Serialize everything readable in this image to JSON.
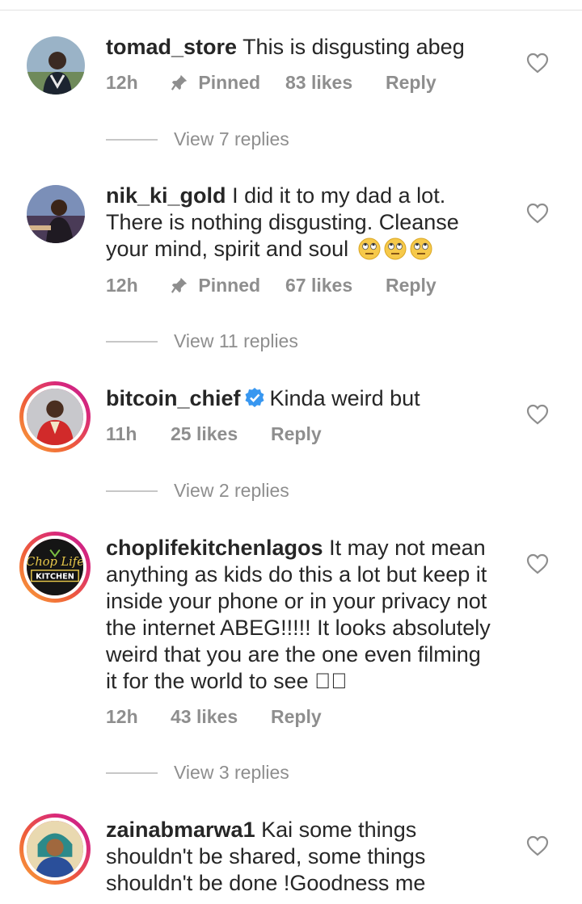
{
  "comments": [
    {
      "username": "tomad_store",
      "text": "This is disgusting abeg",
      "time": "12h",
      "pinned_label": "Pinned",
      "likes": "83 likes",
      "reply_label": "Reply",
      "view_replies": "View 7 replies",
      "avatar_ring": false
    },
    {
      "username": "nik_ki_gold",
      "text_lines": [
        "I did it to my dad a lot.",
        "There is nothing disgusting. Cleanse",
        "your mind, spirit and soul"
      ],
      "emoji": [
        "face-with-rolling-eyes-icon",
        "face-with-rolling-eyes-icon",
        "face-with-rolling-eyes-icon"
      ],
      "time": "12h",
      "pinned_label": "Pinned",
      "likes": "67 likes",
      "reply_label": "Reply",
      "view_replies": "View 11 replies",
      "avatar_ring": false
    },
    {
      "username": "bitcoin_chief",
      "verified": true,
      "text": "Kinda weird but",
      "time": "11h",
      "likes": "25 likes",
      "reply_label": "Reply",
      "view_replies": "View 2 replies",
      "avatar_ring": true
    },
    {
      "username": "choplifekitchenlagos",
      "text_lines": [
        "It may not mean",
        "anything as kids do this a lot but keep it",
        "inside your phone or in your privacy not",
        "the internet ABEG!!!!! It looks absolutely",
        "weird that you are the one even filming",
        "it for the world to see \u0000\u0000"
      ],
      "avatar_text": "Chop Life",
      "avatar_subtext": "KITCHEN",
      "time": "12h",
      "likes": "43 likes",
      "reply_label": "Reply",
      "view_replies": "View 3 replies",
      "avatar_ring": true
    },
    {
      "username": "zainabmarwa1",
      "text_lines": [
        "Kai some things",
        "shouldn't be shared, some things",
        "shouldn't be done !Goodness me"
      ],
      "avatar_ring": true
    }
  ],
  "colors": {
    "text": "#262626",
    "meta": "#8e8e8e",
    "verified": "#3897f0",
    "ring_start": "#f9a43a",
    "ring_end": "#c21e8d"
  }
}
